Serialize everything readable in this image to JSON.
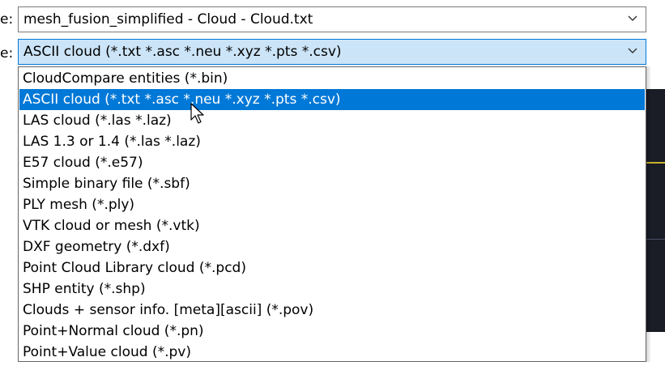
{
  "filename": {
    "label": "e:",
    "value": "mesh_fusion_simplified - Cloud - Cloud.txt"
  },
  "save_type": {
    "label": "e:",
    "selected": "ASCII cloud (*.txt *.asc *.neu *.xyz *.pts *.csv)"
  },
  "options": [
    "CloudCompare entities (*.bin)",
    "ASCII cloud (*.txt *.asc *.neu *.xyz *.pts *.csv)",
    "LAS cloud (*.las *.laz)",
    "LAS 1.3 or 1.4 (*.las *.laz)",
    "E57 cloud (*.e57)",
    "Simple binary file (*.sbf)",
    "PLY mesh (*.ply)",
    "VTK cloud or mesh (*.vtk)",
    "DXF geometry (*.dxf)",
    "Point Cloud Library cloud (*.pcd)",
    "SHP entity (*.shp)",
    "Clouds + sensor info. [meta][ascii] (*.pov)",
    "Point+Normal cloud (*.pn)",
    "Point+Value cloud (*.pv)"
  ],
  "highlighted_index": 1,
  "colors": {
    "highlight": "#0078d7",
    "combo_focus_bg": "#cce4f7"
  },
  "icons": {
    "dropdown": "chevron-down-icon",
    "cursor": "mouse-pointer-icon"
  }
}
